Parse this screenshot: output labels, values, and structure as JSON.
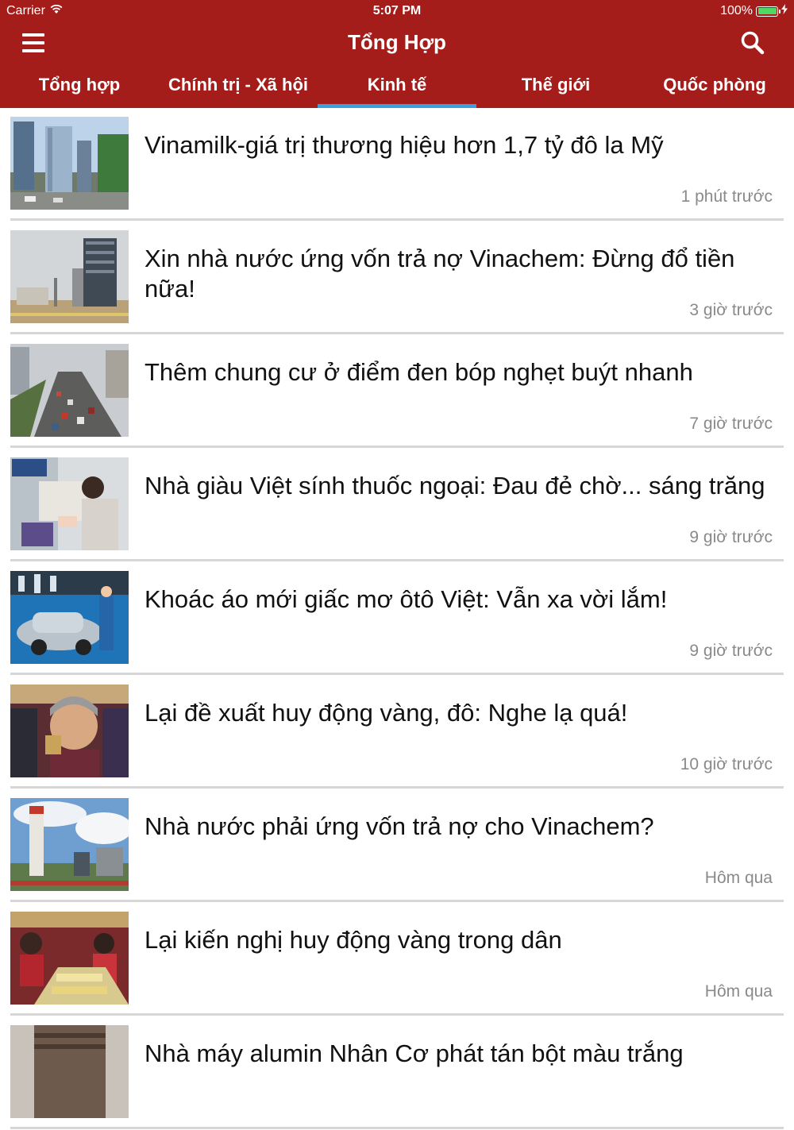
{
  "status_bar": {
    "carrier": "Carrier",
    "time": "5:07 PM",
    "battery": "100%"
  },
  "nav": {
    "title": "Tổng Hợp",
    "menu_icon": "hamburger-menu-icon",
    "search_icon": "search-icon"
  },
  "tabs": [
    {
      "label": "Tổng hợp",
      "active": false
    },
    {
      "label": "Chính trị - Xã hội",
      "active": false
    },
    {
      "label": "Kinh tế",
      "active": true
    },
    {
      "label": "Thế giới",
      "active": false
    },
    {
      "label": "Quốc phòng",
      "active": false
    }
  ],
  "colors": {
    "header": "#a51d1b",
    "active_tab_indicator": "#3aa0dd",
    "time_text": "#8a8a8a",
    "divider": "#d6d6d6"
  },
  "articles": [
    {
      "title": "Vinamilk-giá trị thương hiệu hơn 1,7 tỷ đô la Mỹ",
      "time": "1 phút trước"
    },
    {
      "title": "Xin nhà nước ứng vốn trả nợ Vinachem: Đừng đổ tiền nữa!",
      "time": "3 giờ trước"
    },
    {
      "title": "Thêm chung cư ở điểm đen bóp nghẹt buýt nhanh",
      "time": "7 giờ trước"
    },
    {
      "title": "Nhà giàu Việt sính thuốc ngoại: Đau đẻ chờ... sáng trăng",
      "time": "9 giờ trước"
    },
    {
      "title": "Khoác áo mới giấc mơ ôtô Việt: Vẫn xa vời lắm!",
      "time": "9 giờ trước"
    },
    {
      "title": "Lại đề xuất huy động vàng, đô: Nghe lạ quá!",
      "time": "10 giờ trước"
    },
    {
      "title": "Nhà nước phải ứng vốn trả nợ cho Vinachem?",
      "time": "Hôm qua"
    },
    {
      "title": "Lại kiến nghị huy động vàng trong dân",
      "time": "Hôm qua"
    },
    {
      "title": "Nhà máy alumin Nhân Cơ phát tán bột màu trắng",
      "time": ""
    }
  ]
}
